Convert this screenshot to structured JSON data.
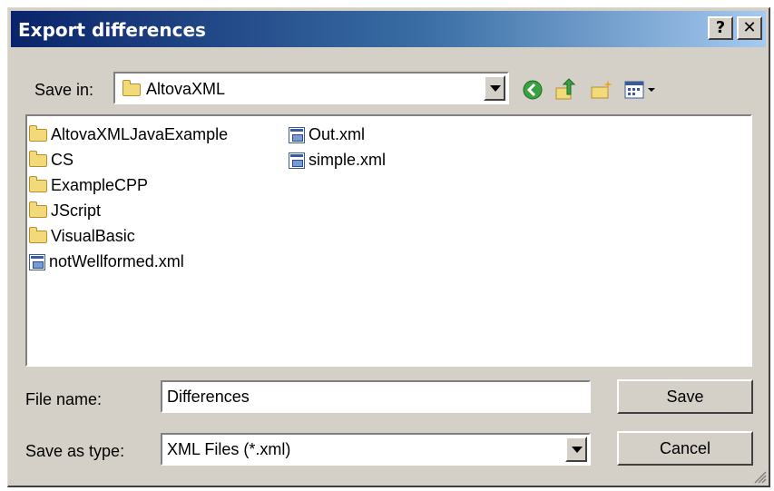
{
  "window": {
    "title": "Export differences",
    "help_button": "?",
    "close_button": "✕"
  },
  "save_in": {
    "label": "Save in:",
    "value": "AltovaXML"
  },
  "files": [
    {
      "name": "AltovaXMLJavaExample",
      "type": "folder"
    },
    {
      "name": "CS",
      "type": "folder"
    },
    {
      "name": "ExampleCPP",
      "type": "folder"
    },
    {
      "name": "JScript",
      "type": "folder"
    },
    {
      "name": "VisualBasic",
      "type": "folder"
    },
    {
      "name": "notWellformed.xml",
      "type": "xml"
    },
    {
      "name": "Out.xml",
      "type": "xml"
    },
    {
      "name": "simple.xml",
      "type": "xml"
    }
  ],
  "filename": {
    "label": "File name:",
    "value": "Differences"
  },
  "savetype": {
    "label": "Save as type:",
    "value": "XML Files (*.xml)"
  },
  "buttons": {
    "save": "Save",
    "cancel": "Cancel"
  },
  "colors": {
    "titlebar_start": "#0a246a",
    "titlebar_end": "#a6caf0",
    "face": "#d4d0c8"
  }
}
